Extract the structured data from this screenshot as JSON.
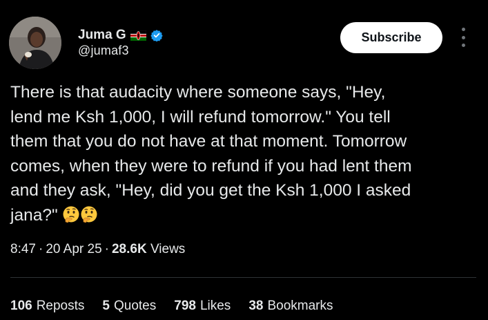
{
  "author": {
    "display_name": "Juma G",
    "handle": "@jumaf3",
    "flag_icon": "kenya-flag-icon",
    "verified_icon": "verified-badge-icon",
    "verified_color": "#1d9bf0"
  },
  "header": {
    "subscribe_label": "Subscribe",
    "more_icon": "more-vertical-icon"
  },
  "tweet": {
    "text": "There is that audacity where someone says, \"Hey,\nlend me Ksh 1,000, I will refund tomorrow.\" You tell\nthem that you do not have at that moment. Tomorrow\ncomes, when they were to refund if you had lent them\nand they ask, \"Hey, did you get the Ksh 1,000 I asked\njana?\" ",
    "emojis": [
      "thinking-face-icon",
      "thinking-face-icon"
    ],
    "time": "8:47",
    "date": "20 Apr 25",
    "views_count": "28.6K",
    "views_label": "Views",
    "separator": "·"
  },
  "stats": [
    {
      "count": "106",
      "label": "Reposts"
    },
    {
      "count": "5",
      "label": "Quotes"
    },
    {
      "count": "798",
      "label": "Likes"
    },
    {
      "count": "38",
      "label": "Bookmarks"
    }
  ],
  "colors": {
    "background": "#000000",
    "text": "#e7e9ea",
    "muted": "#71767b",
    "divider": "#2f3336",
    "button_bg": "#ffffff",
    "button_text": "#0f1419"
  }
}
